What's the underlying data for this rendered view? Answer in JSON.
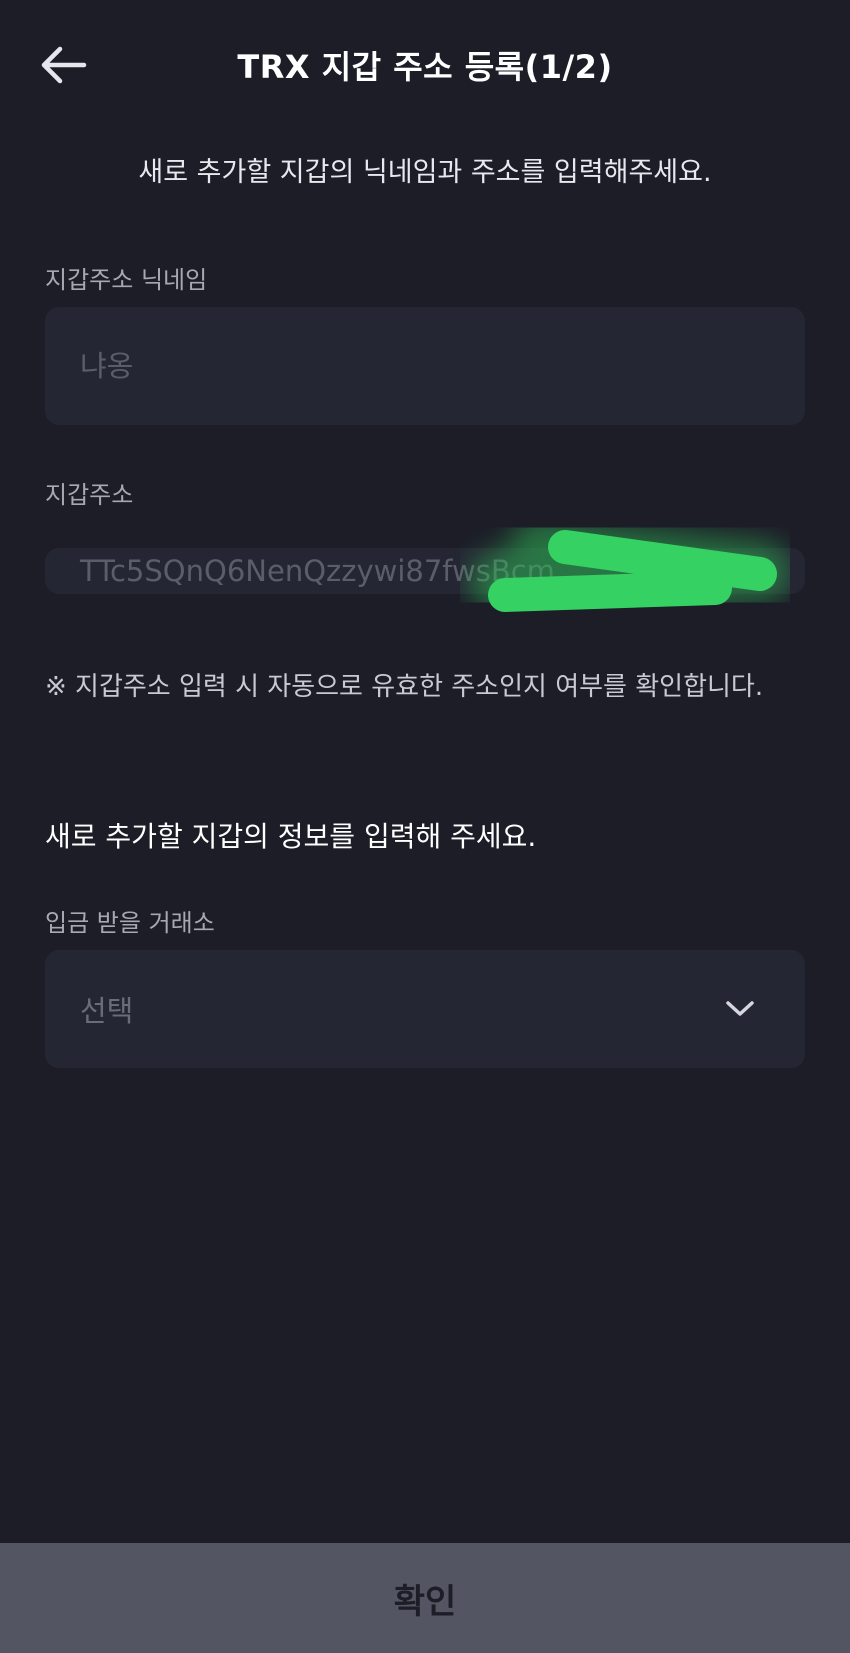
{
  "header": {
    "title": "TRX 지갑 주소 등록(1/2)"
  },
  "intro_text": "새로 추가할 지갑의 닉네임과 주소를 입력해주세요.",
  "nickname": {
    "label": "지갑주소 닉네임",
    "placeholder": "냐옹"
  },
  "address": {
    "label": "지갑주소",
    "value": "TTc5SQnQ6NenQzzywi87fwsBcm"
  },
  "note": "※ 지갑주소 입력 시 자동으로 유효한 주소인지 여부를 확인합니다.",
  "section_title": "새로 추가할 지갑의 정보를 입력해 주세요.",
  "exchange": {
    "label": "입금 받을 거래소",
    "selected": "선택"
  },
  "confirm_label": "확인",
  "colors": {
    "background": "#1d1d28",
    "field": "#252633",
    "button": "#545563",
    "redaction": "#35d163"
  }
}
